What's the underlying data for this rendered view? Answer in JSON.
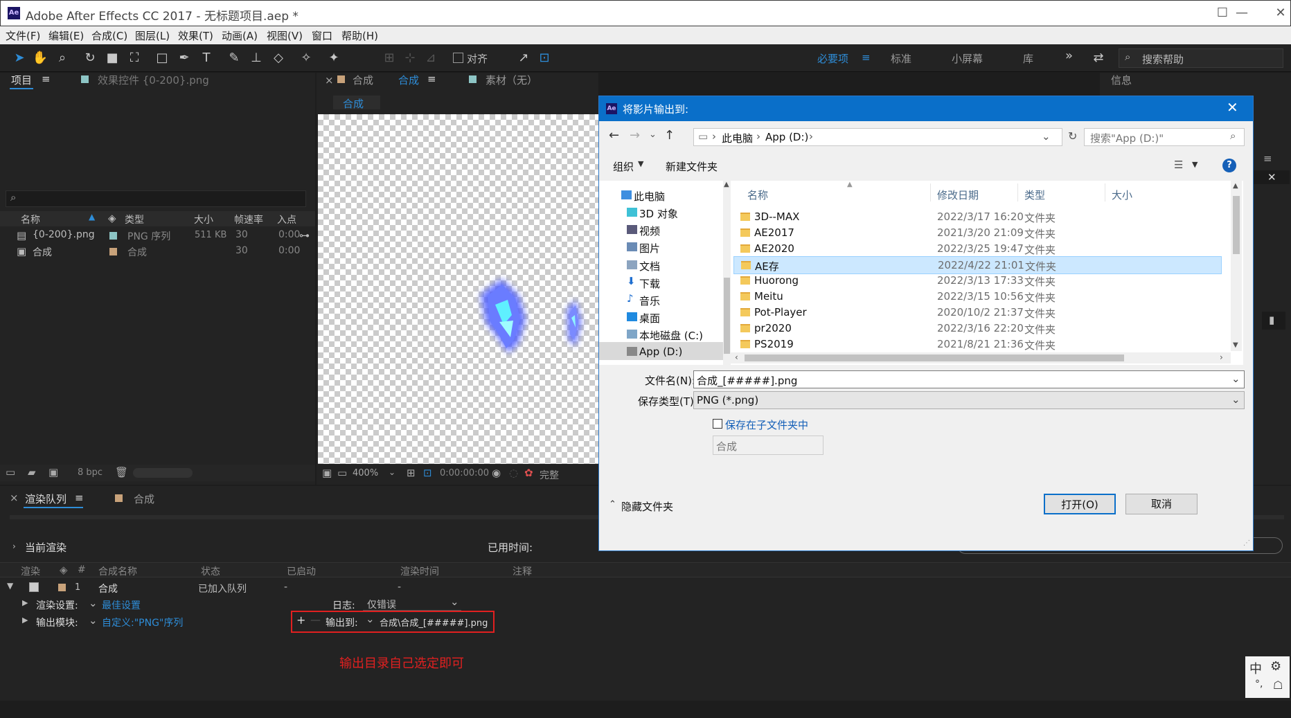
{
  "app": {
    "title": "Adobe After Effects CC 2017 - 无标题项目.aep *",
    "logo": "Ae",
    "min": "—",
    "max": "☐",
    "close": "✕"
  },
  "menu": [
    "文件(F)",
    "编辑(E)",
    "合成(C)",
    "图层(L)",
    "效果(T)",
    "动画(A)",
    "视图(V)",
    "窗口",
    "帮助(H)"
  ],
  "toolbar": {
    "align": "对齐",
    "workspaces": [
      "必要项",
      "标准",
      "小屏幕",
      "库"
    ],
    "search_placeholder": "搜索帮助",
    "more": "»",
    "menu": "≡"
  },
  "project_panel": {
    "tab": "项目",
    "menu": "≡",
    "effect_tab": "效果控件 {0-200}.png",
    "columns": [
      "名称",
      "类型",
      "大小",
      "帧速率",
      "入点"
    ],
    "items": [
      {
        "name": "{0-200}.png",
        "type": "PNG 序列",
        "size": "511 KB",
        "fps": "30",
        "in": "0:00"
      },
      {
        "name": "合成",
        "type": "合成",
        "size": "",
        "fps": "30",
        "in": "0:00"
      }
    ],
    "bpc": "8 bpc",
    "search_icon": "⌕"
  },
  "comp_panel": {
    "close": "×",
    "tab_prefix": "合成",
    "tab_name": "合成",
    "menu": "≡",
    "footage_tab": "素材（无）",
    "subtab": "合成",
    "zoom": "400%",
    "timecode": "0:00:00:00",
    "quality": "完整"
  },
  "info_panel": {
    "tab": "信息",
    "menu": "≡",
    "close": "✕"
  },
  "render_queue": {
    "tab": "渲染队列",
    "menu": "≡",
    "comp_tab": "合成",
    "current_render": "当前渲染",
    "elapsed": "已用时间:",
    "columns": [
      "渲染",
      "#",
      "合成名称",
      "状态",
      "已启动",
      "渲染时间",
      "注释"
    ],
    "item": {
      "index": "1",
      "name": "合成",
      "status": "已加入队列",
      "started": "-",
      "time": "-"
    },
    "render_settings_label": "渲染设置:",
    "render_settings_value": "最佳设置",
    "log_label": "日志:",
    "log_value": "仅错误",
    "output_module_label": "输出模块:",
    "output_module_value": "自定义:\"PNG\"序列",
    "output_to_label": "输出到:",
    "output_to_value": "合成\\合成_[#####].png",
    "plus": "+",
    "minus": "—"
  },
  "annotation": "输出目录自己选定即可",
  "dialog": {
    "title": "将影片输出到:",
    "logo": "Ae",
    "close": "✕",
    "path": [
      "此电脑",
      "App (D:)"
    ],
    "search_placeholder": "搜索\"App (D:)\"",
    "organize": "组织",
    "new_folder": "新建文件夹",
    "help": "?",
    "nav": [
      "此电脑",
      "3D 对象",
      "视频",
      "图片",
      "文档",
      "下载",
      "音乐",
      "桌面",
      "本地磁盘 (C:)",
      "App (D:)"
    ],
    "columns": [
      "名称",
      "修改日期",
      "类型",
      "大小"
    ],
    "files": [
      {
        "name": "3D--MAX",
        "date": "2022/3/17 16:20",
        "type": "文件夹"
      },
      {
        "name": "AE2017",
        "date": "2021/3/20 21:09",
        "type": "文件夹"
      },
      {
        "name": "AE2020",
        "date": "2022/3/25 19:47",
        "type": "文件夹"
      },
      {
        "name": "AE存",
        "date": "2022/4/22 21:01",
        "type": "文件夹"
      },
      {
        "name": "Huorong",
        "date": "2022/3/13 17:33",
        "type": "文件夹"
      },
      {
        "name": "Meitu",
        "date": "2022/3/15 10:56",
        "type": "文件夹"
      },
      {
        "name": "Pot-Player",
        "date": "2020/10/2 21:37",
        "type": "文件夹"
      },
      {
        "name": "pr2020",
        "date": "2022/3/16 22:20",
        "type": "文件夹"
      },
      {
        "name": "PS2019",
        "date": "2021/8/21 21:36",
        "type": "文件夹"
      }
    ],
    "filename_label": "文件名(N):",
    "filename_value": "合成_[#####].png",
    "filetype_label": "保存类型(T):",
    "filetype_value": "PNG (*.png)",
    "subfolder_label": "保存在子文件夹中",
    "subfolder_value": "合成",
    "hide_folders": "隐藏文件夹",
    "open": "打开(O)",
    "cancel": "取消"
  },
  "colors": {
    "accent": "#2e8dd8",
    "dialog_title": "#0a6fc9",
    "annotation": "#e22020",
    "selected_row": "#cce8ff"
  }
}
